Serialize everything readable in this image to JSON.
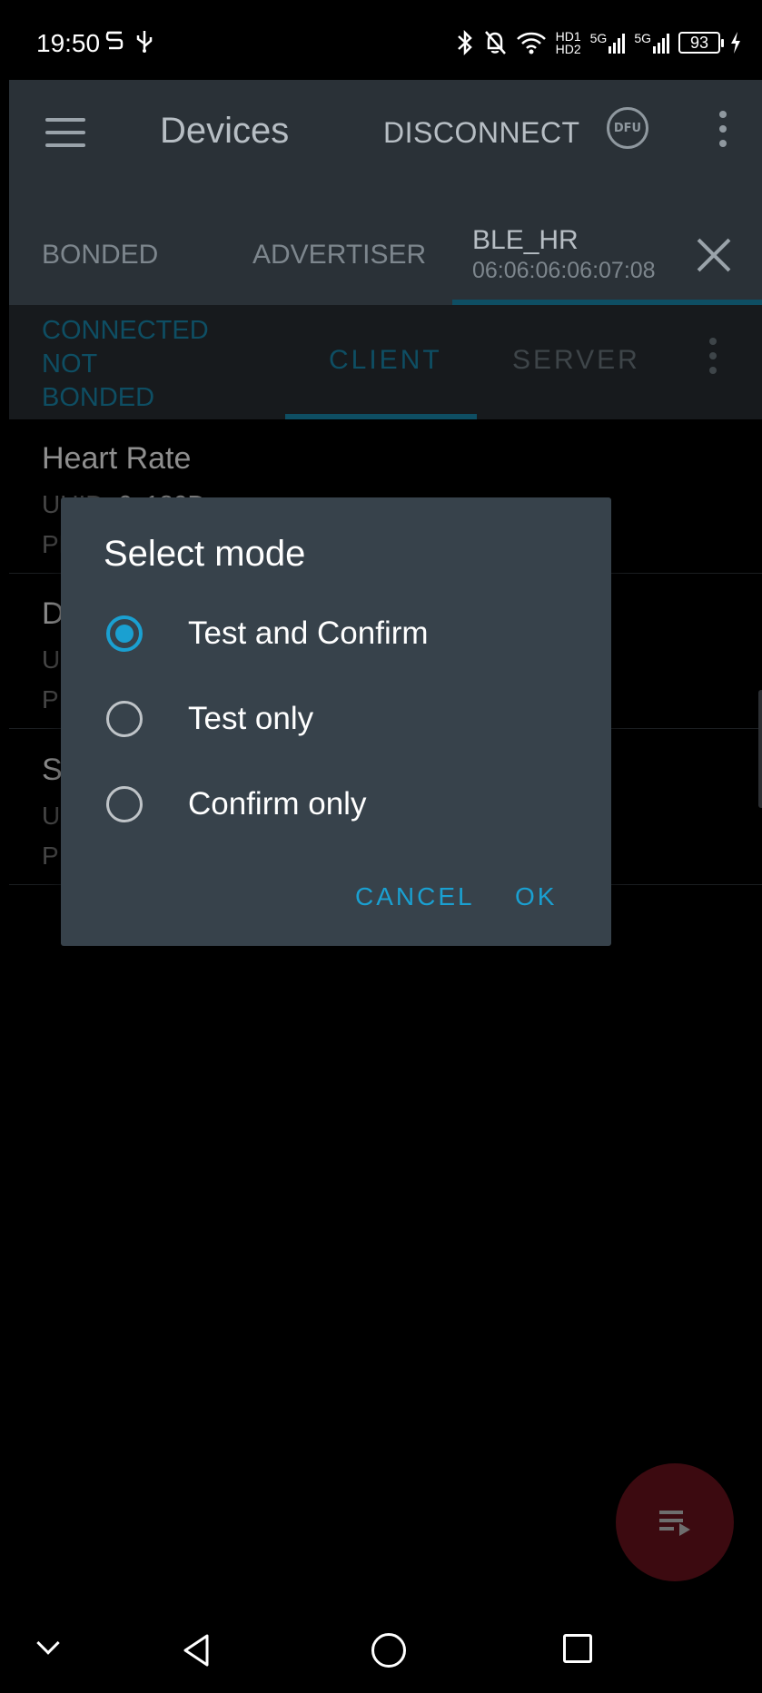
{
  "status_bar": {
    "time": "19:50",
    "hd1": "HD1",
    "hd2": "HD2",
    "sig1": "5G",
    "sig2": "5G",
    "battery": "93"
  },
  "app_bar": {
    "title": "Devices",
    "disconnect_label": "DISCONNECT",
    "dfu_label": "DFU"
  },
  "device_tabs": {
    "bonded": "BONDED",
    "advertiser": "ADVERTISER",
    "active_name": "BLE_HR",
    "active_address": "06:06:06:06:07:08"
  },
  "connection": {
    "state_line1": "CONNECTED",
    "state_line2": "NOT",
    "state_line3": "BONDED",
    "tab_client": "CLIENT",
    "tab_server": "SERVER"
  },
  "services": [
    {
      "name": "Heart Rate",
      "uuid_label": "UUID:",
      "uuid": "0x180D",
      "type": "PRIMARY SERVICE"
    },
    {
      "name": "D",
      "uuid_label": "U",
      "uuid": "",
      "type": "P"
    },
    {
      "name": "S",
      "uuid_label": "U",
      "uuid": "",
      "type": "P"
    }
  ],
  "dialog": {
    "title": "Select mode",
    "options": [
      {
        "label": "Test and Confirm",
        "selected": true
      },
      {
        "label": "Test only",
        "selected": false
      },
      {
        "label": "Confirm only",
        "selected": false
      }
    ],
    "cancel_label": "CANCEL",
    "ok_label": "OK"
  },
  "colors": {
    "accent": "#1aa0d1",
    "dialog_bg": "#37424b",
    "app_bar_dim": "#2a3137",
    "fab_dim": "#3c0a10"
  },
  "icons": [
    "vpn-icon",
    "usb-icon",
    "bluetooth-icon",
    "bell-off-icon",
    "wifi-icon",
    "signal-icon",
    "battery-icon",
    "charging-icon",
    "menu-icon",
    "dfu-icon",
    "more-vert-icon",
    "close-icon",
    "queue-play-icon",
    "nav-collapse-icon",
    "nav-back-icon",
    "nav-home-icon",
    "nav-recents-icon"
  ]
}
